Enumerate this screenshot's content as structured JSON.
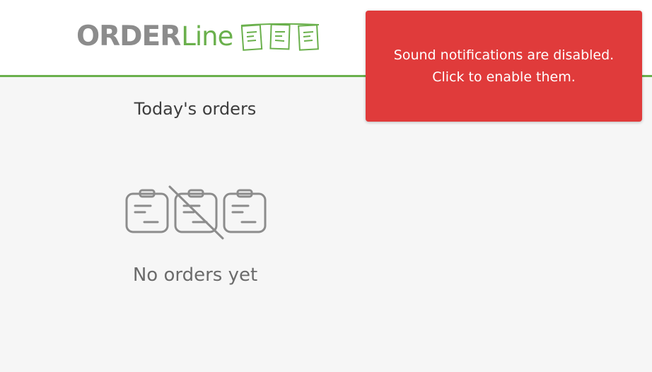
{
  "header": {
    "logo": {
      "word_order": "ORDER",
      "word_line": "Line",
      "tickets_icon": "hanging-tickets-icon"
    }
  },
  "toast": {
    "line1": "Sound notifications are disabled.",
    "line2": "Click to enable them.",
    "background_color": "#e03b3b"
  },
  "main": {
    "section_title": "Today's orders",
    "empty_icon": "no-orders-icon",
    "empty_text": "No orders yet"
  },
  "colors": {
    "accent_green": "#6ab04c",
    "logo_gray": "#8c8c8c",
    "icon_gray": "#8c8c8c",
    "background": "#f6f6f6"
  }
}
